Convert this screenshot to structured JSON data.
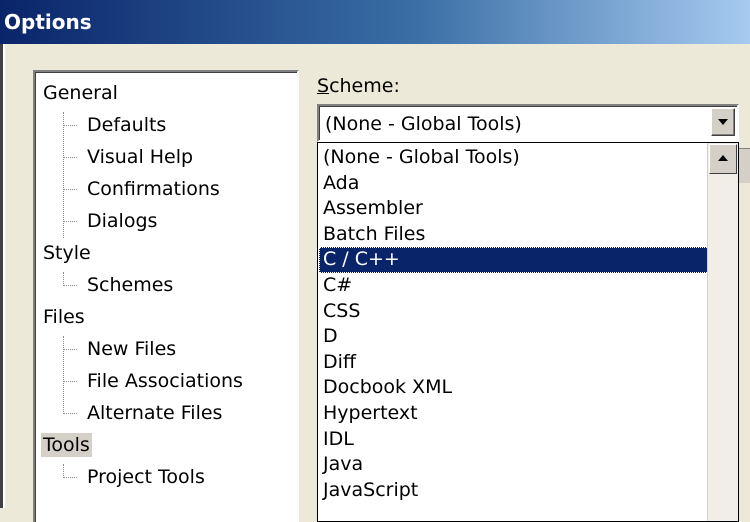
{
  "window": {
    "title": "Options"
  },
  "tree": {
    "items": [
      {
        "label": "General",
        "level": 0
      },
      {
        "label": "Defaults",
        "level": 1
      },
      {
        "label": "Visual Help",
        "level": 1
      },
      {
        "label": "Confirmations",
        "level": 1
      },
      {
        "label": "Dialogs",
        "level": 1
      },
      {
        "label": "Style",
        "level": 0
      },
      {
        "label": "Schemes",
        "level": 1
      },
      {
        "label": "Files",
        "level": 0
      },
      {
        "label": "New Files",
        "level": 1
      },
      {
        "label": "File Associations",
        "level": 1
      },
      {
        "label": "Alternate Files",
        "level": 1
      },
      {
        "label": "Tools",
        "level": 0,
        "selected": true
      },
      {
        "label": "Project Tools",
        "level": 1
      }
    ]
  },
  "scheme": {
    "label_accel": "S",
    "label_rest": "cheme:",
    "selected_value": "(None - Global Tools)",
    "options": [
      "(None - Global Tools)",
      "Ada",
      "Assembler",
      "Batch Files",
      "C / C++",
      "C#",
      "CSS",
      "D",
      "Diff",
      "Docbook XML",
      "Hypertext",
      "IDL",
      "Java",
      "JavaScript"
    ],
    "highlighted_option": "C / C++"
  },
  "colors": {
    "title_bar": "#0a246a",
    "selection": "#0a246a",
    "dialog_bg": "#ece9d8"
  }
}
